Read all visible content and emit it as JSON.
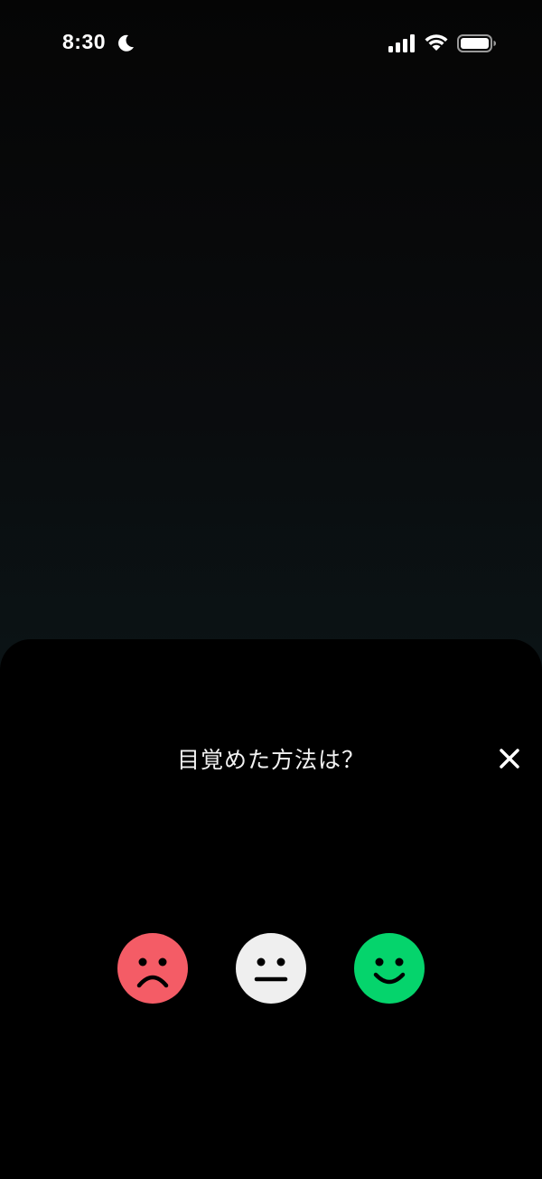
{
  "status_bar": {
    "time": "8:30",
    "focus_icon": "moon-icon",
    "signal_icon": "cellular-signal-icon",
    "wifi_icon": "wifi-icon",
    "battery_icon": "battery-icon"
  },
  "sheet": {
    "title": "目覚めた方法は？",
    "close_icon": "close-icon",
    "options": [
      {
        "name": "sad-face-icon",
        "color": "#f45c66"
      },
      {
        "name": "neutral-face-icon",
        "color": "#efefef"
      },
      {
        "name": "happy-face-icon",
        "color": "#05d46c"
      }
    ]
  }
}
